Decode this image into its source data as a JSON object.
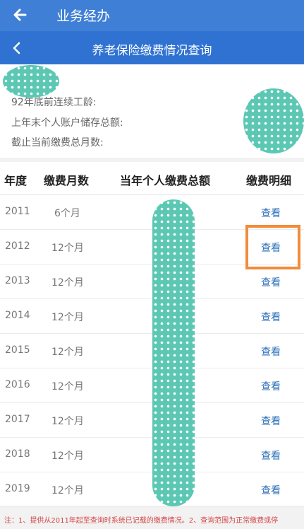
{
  "appbar": {
    "title": "业务经办"
  },
  "subbar": {
    "title": "养老保险缴费情况查询"
  },
  "info": {
    "row1": "92年底前连续工龄:",
    "row2": "上年末个人账户储存总额:",
    "row3": "截止当前缴费总月数:"
  },
  "table": {
    "headers": [
      "年度",
      "缴费月数",
      "当年个人缴费总额",
      "缴费明细"
    ],
    "rows": [
      {
        "year": "2011",
        "months": "6个月",
        "action": "查看"
      },
      {
        "year": "2012",
        "months": "12个月",
        "action": "查看"
      },
      {
        "year": "2013",
        "months": "12个月",
        "action": "查看"
      },
      {
        "year": "2014",
        "months": "12个月",
        "action": "查看"
      },
      {
        "year": "2015",
        "months": "12个月",
        "action": "查看"
      },
      {
        "year": "2016",
        "months": "12个月",
        "action": "查看"
      },
      {
        "year": "2017",
        "months": "12个月",
        "action": "查看"
      },
      {
        "year": "2018",
        "months": "12个月",
        "action": "查看"
      },
      {
        "year": "2019",
        "months": "12个月",
        "action": "查看"
      }
    ]
  },
  "note": "注：1、提供从2011年起至查询时系统已记载的缴费情况。2、查询范围为正常缴费或停",
  "colors": {
    "appbar": "#3f7fd6",
    "subbar": "#2f72d2",
    "link": "#2b6fb6",
    "highlight": "#f28c3a"
  }
}
